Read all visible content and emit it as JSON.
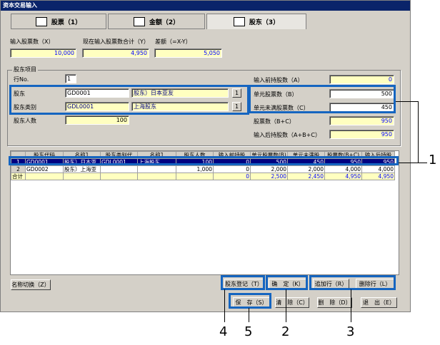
{
  "window": {
    "title": "资本交易输入"
  },
  "tabs": [
    {
      "label": "股票（1）"
    },
    {
      "label": "金额（2）"
    },
    {
      "label": "股东（3）"
    }
  ],
  "summary": {
    "input_shares_label": "输入股票数（X）",
    "input_shares_value": "10,000",
    "current_total_label": "现在输入股票数合计（Y）",
    "current_total_value": "4,950",
    "diff_label": "差额（=X-Y）",
    "diff_value": "5,050"
  },
  "section_title": "股东项目",
  "form": {
    "row_no_label": "行No.",
    "row_no_value": "1",
    "shareholder_label": "股东",
    "shareholder_code": "GD0001",
    "shareholder_name": "股东）日本亚友",
    "shareholder_type_label": "股东类别",
    "shareholder_type_code": "GDL0001",
    "shareholder_type_name": "上海股东",
    "people_label": "股东人数",
    "people_value": "100",
    "pre_input_label": "输入前持股数（A）",
    "pre_input_value": "0",
    "unit_shares_label": "单元股票数（B）",
    "unit_shares_value": "500",
    "under_unit_label": "单元未满股票数（C）",
    "under_unit_value": "450",
    "shares_label": "股票数（B+C）",
    "shares_value": "950",
    "post_input_label": "输入后持股数（A+B+C）",
    "post_input_value": "950",
    "lookup_btn": "1"
  },
  "grid": {
    "columns": [
      "",
      "股东代码",
      "名称1",
      "股东类别代",
      "名称1",
      "股东人数",
      "输入前持股",
      "单元股票数(B)",
      "单元未满股",
      "股票数(B+C)",
      "输入后持股"
    ],
    "rows": [
      [
        "1",
        "GD0001",
        "股东）日本亚",
        "GDL0001",
        "上海股东",
        "100",
        "0",
        "500",
        "450",
        "950",
        "950"
      ],
      [
        "2",
        "GD0002",
        "股东）上海亚",
        "",
        "",
        "1,000",
        "0",
        "2,000",
        "2,000",
        "4,000",
        "4,000"
      ]
    ],
    "total": [
      "合计",
      "",
      "",
      "",
      "",
      "",
      "0",
      "2,500",
      "2,450",
      "4,950",
      "4,950"
    ]
  },
  "buttons": {
    "name_switch": "名称切换（Z）",
    "register": "股东登记（T）",
    "confirm": "确　定（K）",
    "add_row": "追加行（R）",
    "delete_row": "删除行（L）",
    "save": "保　存（S）",
    "clear": "清　除（C）",
    "delete": "删　除（D）",
    "exit": "退　出（E）"
  },
  "callouts": [
    "1",
    "2",
    "3",
    "4",
    "5"
  ],
  "colors": {
    "highlight": "#1565c0",
    "title_bar": "#0a246a",
    "field_yellow": "#ffffc0"
  }
}
